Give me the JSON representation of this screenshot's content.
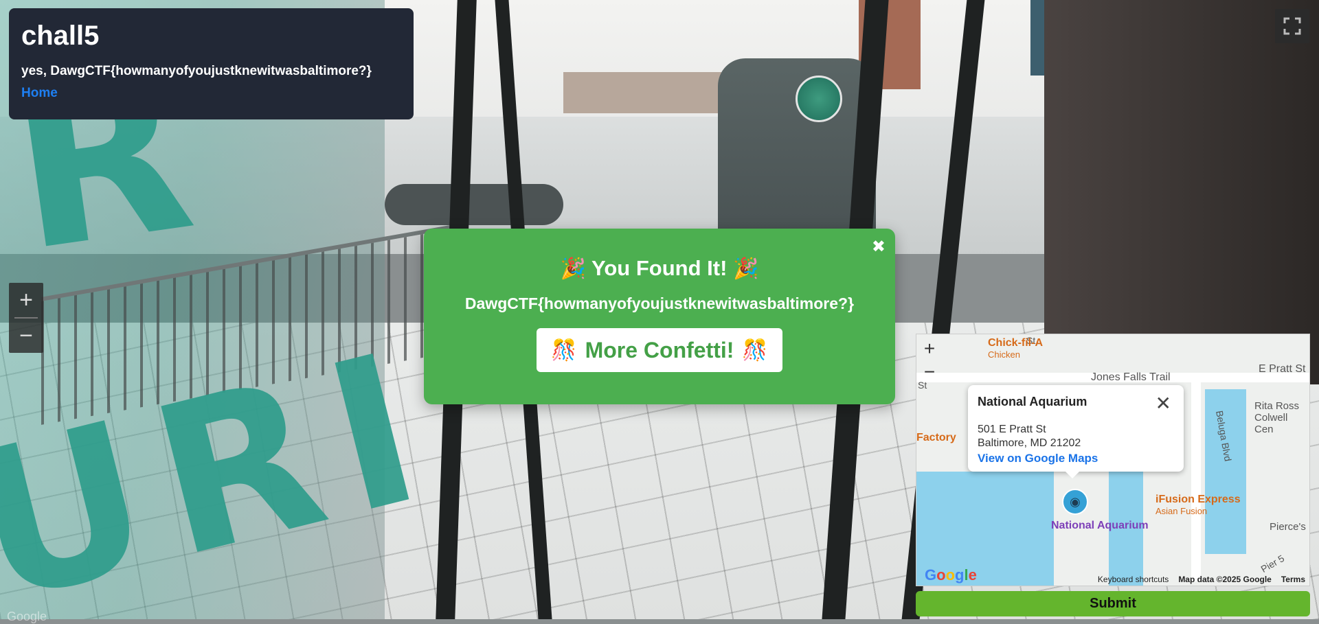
{
  "info_panel": {
    "title": "chall5",
    "subtitle": "yes, DawgCTF{howmanyofyoujustknewitwasbaltimore?}",
    "home_link": "Home"
  },
  "streetview": {
    "fullscreen_icon": "fullscreen-icon",
    "zoom_in": "+",
    "zoom_out": "−",
    "watermark": "Google"
  },
  "modal": {
    "close": "✖",
    "title": "You Found It!",
    "title_emoji": "🎉",
    "flag": "DawgCTF{howmanyofyoujustknewitwasbaltimore?}",
    "button_label": "More Confetti!",
    "button_emoji": "🎊"
  },
  "map": {
    "zoom_in": "+",
    "zoom_out": "−",
    "streets": [
      "Jones Falls Trail",
      "E Pratt St",
      "Beluga Blvd",
      "St",
      "Pier 5"
    ],
    "pois": [
      {
        "name": "Chick-fil-A",
        "sub": "Chicken"
      },
      {
        "name": "iFusion Express",
        "sub": "Asian Fusion"
      },
      {
        "name": "Factory",
        "sub": ""
      },
      {
        "name": "Rita Ross Colwell Cen",
        "sub": ""
      },
      {
        "name": "Pierce's",
        "sub": ""
      }
    ],
    "popup": {
      "title": "National Aquarium",
      "close": "✕",
      "address_line1": "501 E Pratt St",
      "address_line2": "Baltimore, MD 21202",
      "link": "View on Google Maps"
    },
    "pin_label": "National Aquarium",
    "logo": "Google",
    "footer": {
      "shortcuts": "Keyboard shortcuts",
      "data": "Map data ©2025 Google",
      "terms": "Terms"
    },
    "colors": {
      "water": "#8dd1ec",
      "poi": "#d66a19",
      "pin_label": "#7d3fb8"
    }
  },
  "submit": {
    "label": "Submit",
    "color": "#64b52d"
  },
  "colors": {
    "modal_bg": "#4caf50",
    "panel_bg": "#222836",
    "link": "#1e7ff2"
  }
}
